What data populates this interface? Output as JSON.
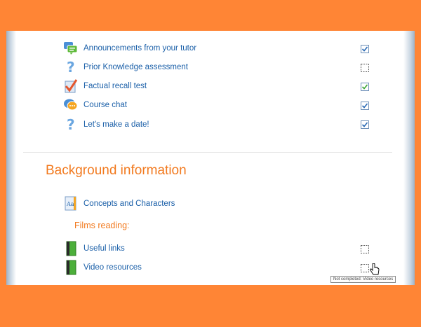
{
  "activities": [
    {
      "label": "Announcements from your tutor",
      "icon": "forum-icon",
      "completion": "checked"
    },
    {
      "label": "Prior Knowledge assessment",
      "icon": "question-icon",
      "completion": "empty"
    },
    {
      "label": "Factual recall test",
      "icon": "quiz-icon",
      "completion": "checked-auto"
    },
    {
      "label": "Course chat",
      "icon": "chat-icon",
      "completion": "checked"
    },
    {
      "label": "Let's make a date!",
      "icon": "question-icon",
      "completion": "checked"
    }
  ],
  "section": {
    "title": "Background information",
    "items": [
      {
        "label": "Concepts and Characters",
        "icon": "glossary-icon"
      }
    ],
    "subheading": "Films reading:",
    "books": [
      {
        "label": "Useful links",
        "icon": "book-icon",
        "completion": "empty"
      },
      {
        "label": "Video resources",
        "icon": "book-icon",
        "completion": "empty"
      }
    ]
  },
  "tooltip": "Not completed: Video resources",
  "colors": {
    "background": "#ff8535",
    "link": "#1a5fa8",
    "heading": "#f27a1f",
    "check": "#2a6ab5",
    "check_auto": "#3aa535"
  }
}
